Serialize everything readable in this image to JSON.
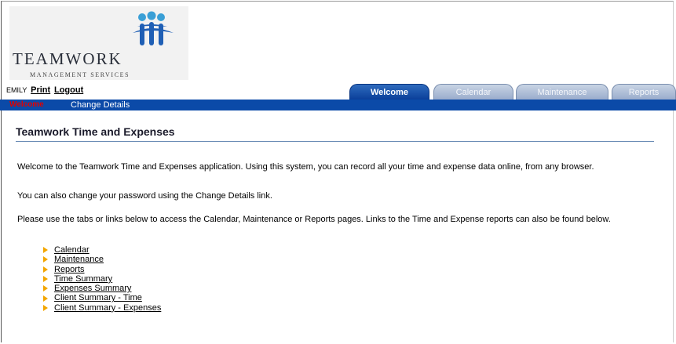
{
  "brand": {
    "name": "TEAMWORK",
    "tagline": "MANAGEMENT SERVICES",
    "logo_icon": "people-logo-icon",
    "colors": {
      "blue": "#1f5fb5",
      "dark": "#2a2f3a"
    }
  },
  "user": {
    "name": "EMILY",
    "print_label": "Print",
    "logout_label": "Logout"
  },
  "tabs": [
    {
      "label": "Welcome",
      "active": true
    },
    {
      "label": "Calendar",
      "active": false
    },
    {
      "label": "Maintenance",
      "active": false
    },
    {
      "label": "Reports",
      "active": false
    }
  ],
  "subnav": {
    "current": "Welcome",
    "change_details": "Change Details"
  },
  "page": {
    "title": "Teamwork Time and Expenses",
    "paragraphs": [
      "Welcome to the Teamwork Time and Expenses application. Using this system, you can record all your time and expense data online, from any browser.",
      "You can also change your password using the Change Details link.",
      "Please use the tabs or links below to access the Calendar, Maintenance or Reports pages. Links to the Time and Expense reports can also be found below."
    ],
    "links": [
      "Calendar",
      "Maintenance",
      "Reports",
      "Time Summary",
      "Expenses Summary",
      "Client Summary - Time",
      "Client Summary - Expenses"
    ]
  },
  "colors": {
    "bar": "#0b4aa8",
    "current_link": "#e00000",
    "bullet": "#f3a600"
  }
}
